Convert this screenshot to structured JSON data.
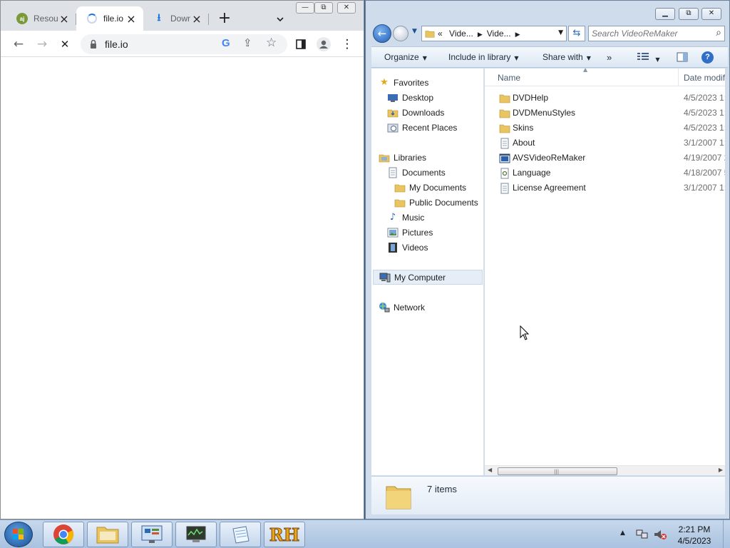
{
  "chrome": {
    "tabs": [
      {
        "title": "Resou",
        "favicon": "aj-favicon"
      },
      {
        "title": "file.io",
        "favicon": "loading-spinner"
      },
      {
        "title": "Down",
        "favicon": "download-icon"
      }
    ],
    "new_tab": "+",
    "tab_search": "⌄",
    "url": "file.io",
    "google_icon": "G",
    "window_controls": {
      "minimize": "—",
      "restore": "⧉",
      "close": "✕"
    }
  },
  "explorer": {
    "breadcrumb": [
      "Vide...",
      "Vide..."
    ],
    "breadcrumb_prefix": "«",
    "search_placeholder": "Search VideoReMaker",
    "commands": {
      "organize": "Organize",
      "include_in_library": "Include in library",
      "share_with": "Share with",
      "more": "»"
    },
    "nav": {
      "favorites": "Favorites",
      "desktop": "Desktop",
      "downloads": "Downloads",
      "recent_places": "Recent Places",
      "libraries": "Libraries",
      "documents": "Documents",
      "my_documents": "My Documents",
      "public_documents": "Public Documents",
      "music": "Music",
      "pictures": "Pictures",
      "videos": "Videos",
      "my_computer": "My Computer",
      "network": "Network"
    },
    "columns": {
      "name": "Name",
      "date_modified": "Date modifi"
    },
    "files": [
      {
        "name": "DVDHelp",
        "date": "4/5/2023 1:",
        "type": "folder"
      },
      {
        "name": "DVDMenuStyles",
        "date": "4/5/2023 1:",
        "type": "folder"
      },
      {
        "name": "Skins",
        "date": "4/5/2023 1:",
        "type": "folder"
      },
      {
        "name": "About",
        "date": "3/1/2007 1:",
        "type": "document"
      },
      {
        "name": "AVSVideoReMaker",
        "date": "4/19/2007 2",
        "type": "application"
      },
      {
        "name": "Language",
        "date": "4/18/2007 5",
        "type": "settings"
      },
      {
        "name": "License Agreement",
        "date": "3/1/2007 1:",
        "type": "document"
      }
    ],
    "status_count": "7 items"
  },
  "taskbar": {
    "apps": [
      "chrome",
      "file-explorer",
      "control-panel",
      "system-monitor",
      "notepad",
      "rh-app"
    ],
    "rh_label": "RH",
    "time": "2:21 PM",
    "date": "4/5/2023"
  }
}
